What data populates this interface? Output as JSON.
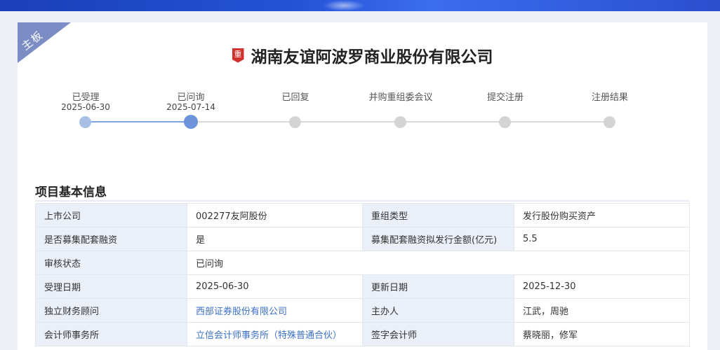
{
  "board_tag": "主板",
  "company_name": "湖南友谊阿波罗商业股份有限公司",
  "badge_char": "重",
  "steps": [
    {
      "label": "已受理",
      "date": "2025-06-30",
      "state": "done"
    },
    {
      "label": "已问询",
      "date": "2025-07-14",
      "state": "current"
    },
    {
      "label": "已回复",
      "date": "",
      "state": "pending"
    },
    {
      "label": "并购重组委会议",
      "date": "",
      "state": "pending"
    },
    {
      "label": "提交注册",
      "date": "",
      "state": "pending"
    },
    {
      "label": "注册结果",
      "date": "",
      "state": "pending"
    }
  ],
  "section_title": "项目基本信息",
  "info": {
    "listed_company_k": "上市公司",
    "listed_company_v": "002277友阿股份",
    "restructure_type_k": "重组类型",
    "restructure_type_v": "发行股份购买资产",
    "supporting_financing_k": "是否募集配套融资",
    "supporting_financing_v": "是",
    "financing_amount_k": "募集配套融资拟发行金额(亿元)",
    "financing_amount_v": "5.5",
    "review_status_k": "审核状态",
    "review_status_v": "已问询",
    "accept_date_k": "受理日期",
    "accept_date_v": "2025-06-30",
    "update_date_k": "更新日期",
    "update_date_v": "2025-12-30",
    "financial_advisor_k": "独立财务顾问",
    "financial_advisor_v": "西部证券股份有限公司",
    "sponsor_k": "主办人",
    "sponsor_v": "江武，周驰",
    "accounting_firm_k": "会计师事务所",
    "accounting_firm_v": "立信会计师事务所（特殊普通合伙）",
    "signing_accountant_k": "签字会计师",
    "signing_accountant_v": "蔡晓丽，修军"
  },
  "colors": {
    "banner": "#2452d6",
    "ribbon": "#7b8dc4",
    "step_current": "#6d94d9",
    "step_done": "#a7bfe5",
    "step_pending": "#d4d4d4",
    "link": "#3a6fc4",
    "badge": "#d0312d"
  }
}
